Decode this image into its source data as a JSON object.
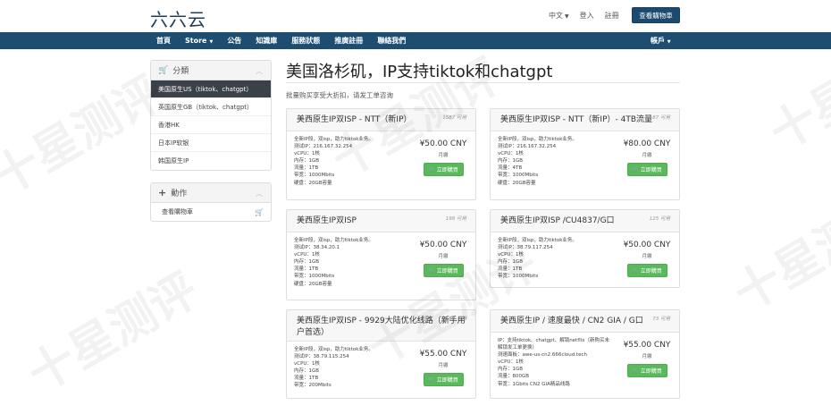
{
  "header": {
    "logo": "六六云",
    "language": "中文",
    "login": "登入",
    "register": "註冊",
    "view_cart": "查看購物車"
  },
  "nav": {
    "items": [
      {
        "label": "首頁"
      },
      {
        "label": "Store",
        "dropdown": true
      },
      {
        "label": "公告"
      },
      {
        "label": "知識庫"
      },
      {
        "label": "服務狀態"
      },
      {
        "label": "推廣註冊"
      },
      {
        "label": "聯絡我們"
      }
    ],
    "account": "帳戶"
  },
  "sidebar": {
    "categories_title": "分類",
    "categories": [
      {
        "label": "美国原生US（tiktok、chatgpt）",
        "active": true
      },
      {
        "label": "英国原生GB（tiktok、chatgpt）",
        "active": false
      },
      {
        "label": "香港HK",
        "active": false
      },
      {
        "label": "日本IP软银",
        "active": false
      },
      {
        "label": "韩国原生IP",
        "active": false
      }
    ],
    "actions_title": "動作",
    "actions": [
      {
        "label": "查看購物車"
      }
    ]
  },
  "main": {
    "title": "美国洛杉矶，IP支持tiktok和chatgpt",
    "subtitle": "批量购买享受大折扣，请发工单咨询"
  },
  "products": [
    {
      "title": "美西原生IP双ISP - NTT（新IP）",
      "available": "1587 可用",
      "features": [
        "全新IP段，双isp，助力tiktok业务。",
        "测试IP：216.167.32.254",
        "vCPU：1核",
        "内存：1GB",
        "流量：1TB",
        "带宽：1000Mbits",
        "硬盘：20GB容量"
      ],
      "price": "¥50.00 CNY",
      "cycle": "月繳",
      "order": "立即購買"
    },
    {
      "title": "美西原生IP双ISP - NTT（新IP）- 4TB流量",
      "available": "187 可用",
      "features": [
        "全新IP段，双isp，助力tiktok业务。",
        "测试IP：216.167.32.254",
        "vCPU：1核",
        "内存：1GB",
        "流量：4TB",
        "带宽：1000Mbits",
        "硬盘：20GB容量"
      ],
      "price": "¥80.00 CNY",
      "cycle": "月繳",
      "order": "立即購買"
    },
    {
      "title": "美西原生IP双ISP",
      "available": "198 可用",
      "features": [
        "全新IP段，双isp，助力tiktok业务。",
        "测试IP：38.34.20.1",
        "vCPU：1核",
        "内存：1GB",
        "流量：1TB",
        "带宽：1000Mbits",
        "硬盘：20GB容量"
      ],
      "price": "¥50.00 CNY",
      "cycle": "月繳",
      "order": "立即購買"
    },
    {
      "title": "美西原生IP双ISP /CU4837/G口",
      "available": "125 可用",
      "features": [
        "全新IP段，双isp，助力tiktok业务。",
        "测试IP：38.79.117.254",
        "vCPU：1核",
        "内存：1GB",
        "流量：1TB",
        "带宽：1000Mbits"
      ],
      "price": "¥50.00 CNY",
      "cycle": "月繳",
      "order": "立即購買"
    },
    {
      "title": "美西原生IP双ISP - 9929大陆优化线路（新手用户首选）",
      "available": "158 可用",
      "features": [
        "全新IP段，双isp，助力tiktok业务。",
        "测试IP：38.79.115.254",
        "vCPU：1核",
        "内存：1GB",
        "流量：1TB",
        "带宽：200Mbits"
      ],
      "price": "¥55.00 CNY",
      "cycle": "月繳",
      "order": "立即購買"
    },
    {
      "title": "美西原生IP / 速度最快 / CN2 GIA / G口",
      "available": "73 可用",
      "features": [
        "IP：支持tiktok、chatgpt、解锁netflix（新购买未解锁发工单更换）",
        "测速面板：awe-us-cn2.666cloud.tech",
        "vCPU：1核",
        "内存：1GB",
        "流量：800GB",
        "带宽：1Gbits CN2 GIA精品线路"
      ],
      "price": "¥55.00 CNY",
      "cycle": "月繳",
      "order": "立即購買"
    }
  ],
  "watermark": "十星测评"
}
